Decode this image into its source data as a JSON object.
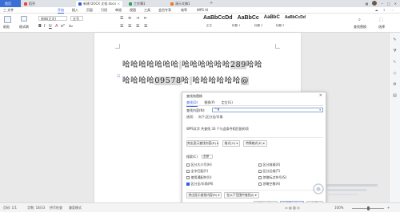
{
  "tabs": [
    {
      "label": "首页",
      "color": "#3b6fd6"
    },
    {
      "label": "稻壳",
      "color": "#e5463f"
    },
    {
      "label": "新建 DOCX 文档.docx",
      "color": "#2b5fd9"
    },
    {
      "label": "工作簿1",
      "color": "#2e9e5b"
    },
    {
      "label": "演示文稿1",
      "color": "#e77b2c"
    }
  ],
  "menu": [
    "三 文件",
    "开始",
    "插入",
    "页面",
    "引用",
    "审阅",
    "视图",
    "工具",
    "会员专享",
    "效率",
    "WPS AI"
  ],
  "menu_active_index": 1,
  "ribbon": {
    "paste": "粘贴",
    "format_painter": "格式刷",
    "font_name": "宋体(正文)",
    "font_size": "五号",
    "styles": [
      "AaBbCcDd",
      "AaBbCc",
      "AaBbC",
      "AaBbCcDd"
    ],
    "style_captions": [
      "正文",
      "标题 1",
      "标题 2",
      "标题 3"
    ],
    "find_replace": "查找替换",
    "select": "选择"
  },
  "document": {
    "line1_a": "哈哈哈哈哈哈哈",
    "line1_hl": " ",
    "line1_b": "哈哈哈哈哈哈",
    "line1_hl2": "289",
    "line1_c": "哈哈",
    "line2_a": "哈哈哈哈",
    "line2_hl": "09578",
    "line2_b": "哈",
    "line2_hl2": " ",
    "line2_c": "哈哈哈哈哈哈",
    "line2_hl3": "@"
  },
  "dialog": {
    "title": "查找和替换",
    "tabs": [
      "查找(D)",
      "替换(P)",
      "定位(G)"
    ],
    "active_tab": 0,
    "find_label": "查找内容(N):",
    "find_value": "^#",
    "options_label": "选项:",
    "options_value": "向下,区分全/半角",
    "result_text": "WPS文字 共查找 33 个与此条件相匹配的项",
    "highlight_btn": "突出显示查找内容(R) ▾",
    "scope_btn": "在以下范围中查找(I) ▾",
    "format_btn": "格式(O) ▾",
    "special_btn": "特殊格式(E) ▾",
    "search_label": "搜索(C)",
    "search_value": "全部",
    "checks_left": [
      {
        "label": "区分大小写(H)",
        "checked": false
      },
      {
        "label": "全字匹配(Y)",
        "checked": false
      },
      {
        "label": "使用通配符(U)",
        "checked": false
      },
      {
        "label": "区分全/半角(M)",
        "checked": true
      }
    ],
    "checks_right": [
      {
        "label": "区分前缀(X)",
        "checked": false
      },
      {
        "label": "区分后缀(T)",
        "checked": false
      },
      {
        "label": "忽略标点符号(S)",
        "checked": false
      },
      {
        "label": "忽略空格(A)",
        "checked": false
      }
    ],
    "bottom_btn_left": "突出显示查找内容(R) ▾",
    "bottom_btn_mid": "在以下范围中查找(I) ▾",
    "help_link": "操作技巧",
    "find_prev": "查找上一处(B)",
    "find_next": "查找下一处(F)",
    "close": "关闭"
  },
  "status": {
    "page": "页码: 1/1",
    "words": "字数: 18/33",
    "spell": "拼写检查",
    "compat": "兼容模式",
    "zoom": "100%",
    "zoom_fraction": 0.5
  },
  "icons": [
    "search-icon",
    "gear-icon",
    "close-icon",
    "pen-icon",
    "cursor-icon",
    "share-icon"
  ]
}
